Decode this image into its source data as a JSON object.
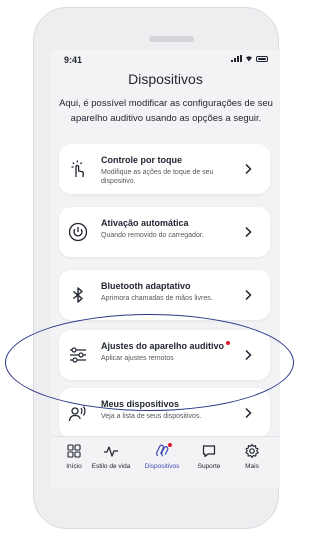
{
  "status": {
    "time": "9:41"
  },
  "header": {
    "title": "Dispositivos",
    "intro": "Aqui, é possível modificar as configurações de seu aparelho auditivo usando as opções a seguir."
  },
  "items": [
    {
      "title": "Controle por toque",
      "subtitle": "Modifique as ações de toque de seu dispositivo.",
      "icon": "touch-icon"
    },
    {
      "title": "Ativação automática",
      "subtitle": "Quando removido do carregador.",
      "icon": "power-icon"
    },
    {
      "title": "Bluetooth adaptativo",
      "subtitle": "Aprimora chamadas de mãos livres.",
      "icon": "bluetooth-icon"
    },
    {
      "title": "Ajustes do aparelho auditivo",
      "subtitle": "Aplicar ajustes remotos",
      "icon": "sliders-icon",
      "badge": true
    },
    {
      "title": "Meus dispositivos",
      "subtitle": "Veja a lista de seus dispositivos.",
      "icon": "person-sound-icon"
    }
  ],
  "tabs": [
    {
      "label": "Início",
      "icon": "grid-icon"
    },
    {
      "label": "Estilo de vida",
      "icon": "pulse-icon"
    },
    {
      "label": "Dispositivos",
      "icon": "hearing-aid-icon",
      "active": true,
      "badge": true
    },
    {
      "label": "Suporte",
      "icon": "chat-icon"
    },
    {
      "label": "Mais",
      "icon": "gear-icon"
    }
  ],
  "colors": {
    "accent": "#3a49b3",
    "badge": "#e21d2b",
    "highlight": "#2b3787"
  }
}
